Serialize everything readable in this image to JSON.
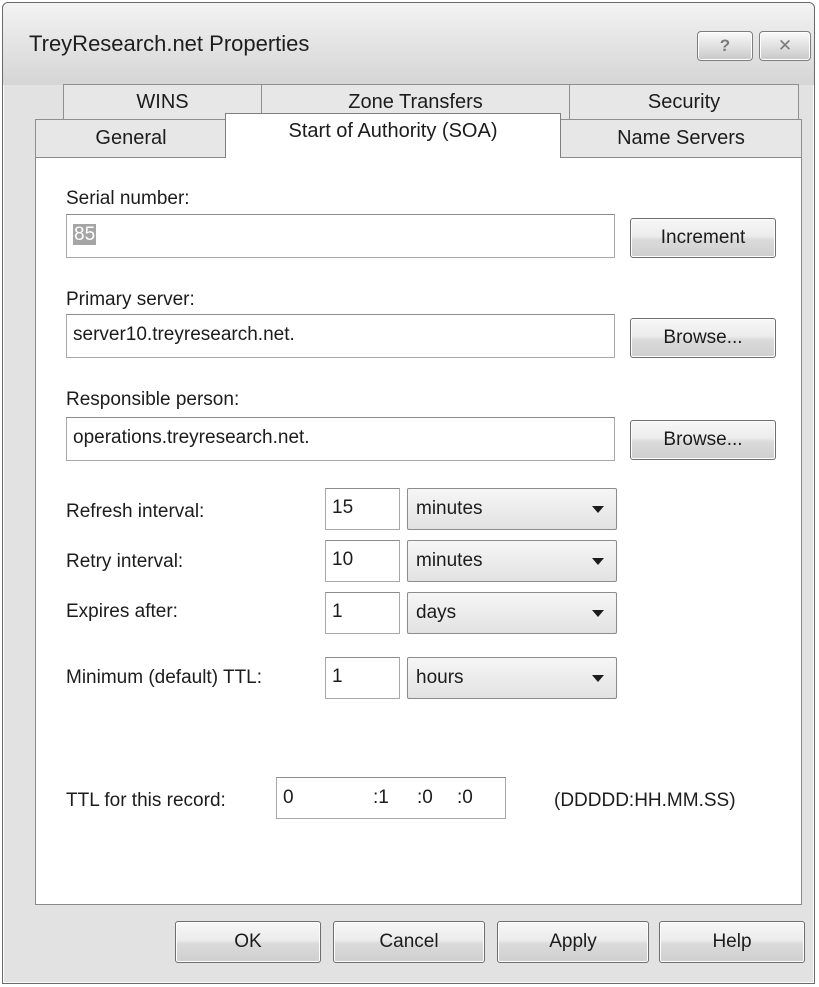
{
  "window": {
    "title": "TreyResearch.net Properties",
    "help_button_glyph": "?",
    "close_button_glyph": "✕"
  },
  "tabs": {
    "row_back": [
      {
        "label": "WINS"
      },
      {
        "label": "Zone Transfers"
      },
      {
        "label": "Security"
      }
    ],
    "row_front": [
      {
        "label": "General"
      },
      {
        "label": "Start of Authority (SOA)",
        "selected": true
      },
      {
        "label": "Name Servers"
      }
    ]
  },
  "soa": {
    "serial": {
      "label": "Serial number:",
      "value": "85",
      "button": "Increment"
    },
    "primary": {
      "label": "Primary server:",
      "value": "server10.treyresearch.net.",
      "button": "Browse..."
    },
    "responsible": {
      "label": "Responsible person:",
      "value": "operations.treyresearch.net.",
      "button": "Browse..."
    },
    "intervals": [
      {
        "label": "Refresh interval:",
        "value": "15",
        "unit": "minutes"
      },
      {
        "label": "Retry interval:",
        "value": "10",
        "unit": "minutes"
      },
      {
        "label": "Expires after:",
        "value": "1",
        "unit": "days"
      },
      {
        "label": "Minimum (default) TTL:",
        "value": "1",
        "unit": "hours"
      }
    ],
    "ttl": {
      "label": "TTL for this record:",
      "days": "0",
      "hours": ":1",
      "minutes": ":0",
      "seconds": ":0",
      "format": "(DDDDD:HH.MM.SS)"
    }
  },
  "footer": {
    "ok": "OK",
    "cancel": "Cancel",
    "apply": "Apply",
    "help": "Help"
  },
  "colors": {
    "window_bg": "#e2e2e2",
    "panel_bg": "#ffffff",
    "selection_bg": "#a5a5a5"
  }
}
